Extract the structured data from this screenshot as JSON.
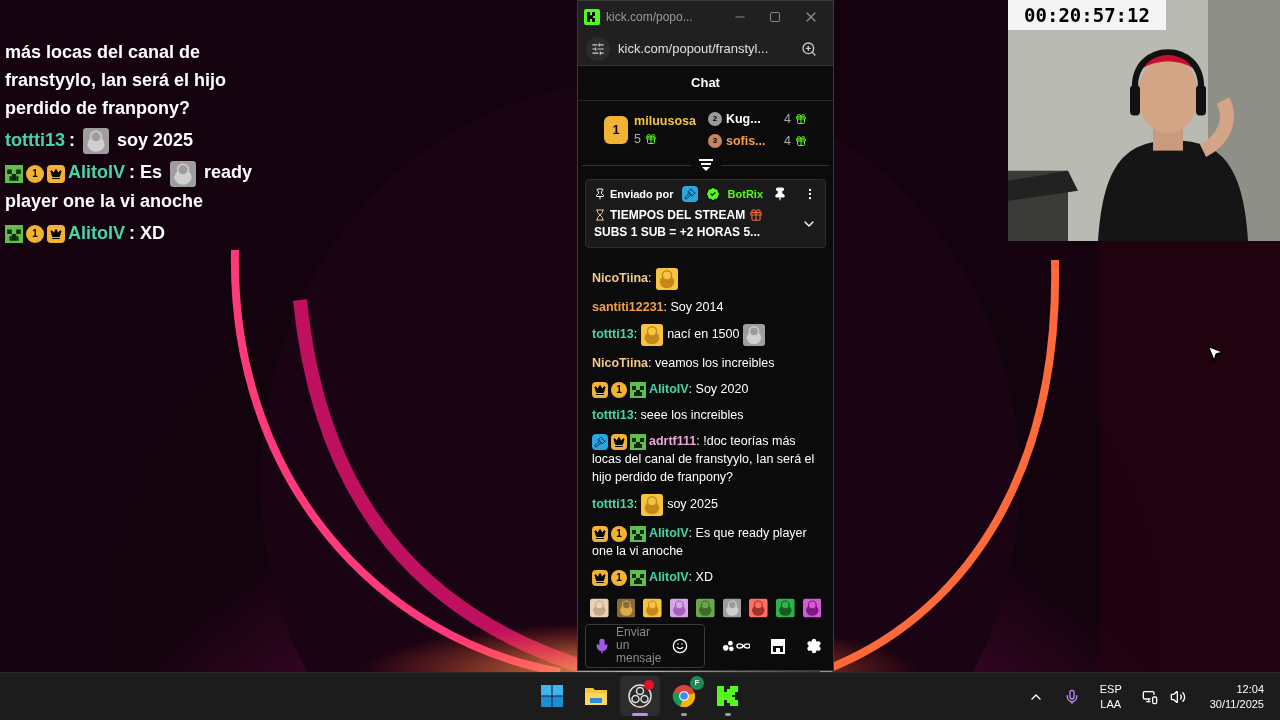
{
  "overlay_chat": {
    "messages": [
      {
        "parts": [
          {
            "kind": "line",
            "text": "más locas del canal de franstyylo, Ian será el hijo perdido de franpony?"
          }
        ]
      },
      {
        "user": "tottti13",
        "color": "#45d6a4",
        "parts": [
          {
            "kind": "text",
            "text": ":"
          },
          {
            "kind": "emote"
          },
          {
            "kind": "text",
            "text": "soy 2025"
          }
        ]
      },
      {
        "badges": [
          {
            "kind": "creeper"
          },
          {
            "kind": "coin",
            "label": "1"
          },
          {
            "kind": "crown"
          }
        ],
        "user": "AlitoIV",
        "color": "#45d6a4",
        "parts": [
          {
            "kind": "text",
            "text": ": Es"
          },
          {
            "kind": "emote"
          },
          {
            "kind": "text",
            "text": "ready"
          },
          {
            "kind": "line",
            "text": "player one la vi anoche"
          }
        ]
      },
      {
        "badges": [
          {
            "kind": "creeper"
          },
          {
            "kind": "coin",
            "label": "1"
          },
          {
            "kind": "crown"
          }
        ],
        "user": "AlitoIV",
        "color": "#45d6a4",
        "parts": [
          {
            "kind": "text",
            "text": ": XD"
          }
        ]
      }
    ]
  },
  "popup": {
    "title": "kick.com/popo...",
    "url": "kick.com/popout/franstyl...",
    "header": "Chat",
    "leaderboard": [
      {
        "rank": "1",
        "name": "miluusosa",
        "count": "5",
        "color": "#f5c542"
      },
      {
        "rank": "2",
        "name": "Kug...",
        "count": "4",
        "color": "#ffffff"
      },
      {
        "rank": "3",
        "name": "sofis...",
        "count": "4",
        "color": "#f5a04a"
      }
    ],
    "pinned": {
      "prefix": "Enviado por",
      "badges": [
        {
          "kind": "hammer"
        },
        {
          "kind": "verified"
        }
      ],
      "user": "BotRix",
      "title": "TIEMPOS DEL STREAM",
      "body": "SUBS 1 SUB = +2 HORAS 5..."
    },
    "messages": [
      {
        "user": "NicoTiina",
        "color": "#f3c98b",
        "parts": [
          {
            "kind": "text",
            "text": ":"
          },
          {
            "kind": "emote"
          }
        ]
      },
      {
        "user": "santiti12231",
        "color": "#f0a040",
        "parts": [
          {
            "kind": "text",
            "text": ": Soy 2014"
          }
        ]
      },
      {
        "user": "tottti13",
        "color": "#45d6a4",
        "parts": [
          {
            "kind": "text",
            "text": ":"
          },
          {
            "kind": "emote"
          },
          {
            "kind": "text",
            "text": "nací en 1500"
          },
          {
            "kind": "emote"
          }
        ]
      },
      {
        "user": "NicoTiina",
        "color": "#f3c98b",
        "parts": [
          {
            "kind": "text",
            "text": ": veamos los increibles"
          }
        ]
      },
      {
        "badges": [
          {
            "kind": "crown"
          },
          {
            "kind": "coin",
            "label": "1"
          },
          {
            "kind": "creeper"
          }
        ],
        "user": "AlitoIV",
        "color": "#45d6a4",
        "parts": [
          {
            "kind": "text",
            "text": ": Soy 2020"
          }
        ]
      },
      {
        "user": "tottti13",
        "color": "#45d6a4",
        "parts": [
          {
            "kind": "text",
            "text": ": seee los increibles"
          }
        ]
      },
      {
        "badges": [
          {
            "kind": "hammer"
          },
          {
            "kind": "crown"
          },
          {
            "kind": "creeper"
          }
        ],
        "user": "adrtf111",
        "color": "#e9a6d9",
        "parts": [
          {
            "kind": "text",
            "text": ": !doc teorías más"
          },
          {
            "kind": "line",
            "text": "locas del canal de franstyylo, Ian será el hijo perdido de franpony?"
          }
        ]
      },
      {
        "user": "tottti13",
        "color": "#45d6a4",
        "parts": [
          {
            "kind": "text",
            "text": ":"
          },
          {
            "kind": "emote"
          },
          {
            "kind": "text",
            "text": "soy 2025"
          }
        ]
      },
      {
        "badges": [
          {
            "kind": "crown"
          },
          {
            "kind": "coin",
            "label": "1"
          },
          {
            "kind": "creeper"
          }
        ],
        "user": "AlitoIV",
        "color": "#45d6a4",
        "parts": [
          {
            "kind": "text",
            "text": ": Es que ready player"
          },
          {
            "kind": "line",
            "text": "one la vi anoche"
          }
        ]
      },
      {
        "badges": [
          {
            "kind": "crown"
          },
          {
            "kind": "coin",
            "label": "1"
          },
          {
            "kind": "creeper"
          }
        ],
        "user": "AlitoIV",
        "color": "#45d6a4",
        "parts": [
          {
            "kind": "text",
            "text": ": XD"
          }
        ]
      }
    ],
    "input": {
      "placeholder": "Enviar un mensaje"
    }
  },
  "webcam": {
    "kind": "picture",
    "timer": "00:20:57:12"
  },
  "taskbar": {
    "apps": [
      {
        "kind": "start",
        "running": false,
        "selected": false
      },
      {
        "kind": "folder",
        "running": false,
        "selected": false
      },
      {
        "kind": "obs",
        "running": true,
        "selected": true,
        "notification": true
      },
      {
        "kind": "chrome",
        "running": true,
        "selected": false,
        "profile": "F"
      },
      {
        "kind": "kick",
        "running": true,
        "selected": false
      }
    ],
    "language": "ESP",
    "layout": "LAA",
    "time": "12:04",
    "date": "30/11/2025"
  }
}
